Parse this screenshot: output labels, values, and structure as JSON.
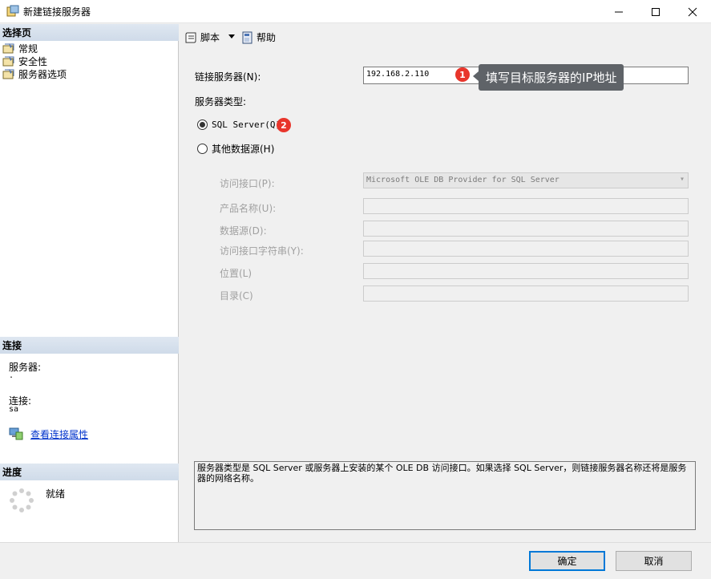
{
  "window": {
    "title": "新建链接服务器",
    "min_icon": "minimize-icon",
    "max_icon": "maximize-icon",
    "close_icon": "close-icon"
  },
  "left": {
    "select_page_header": "选择页",
    "pages": [
      {
        "label": "常规",
        "icon": "page-icon"
      },
      {
        "label": "安全性",
        "icon": "page-icon"
      },
      {
        "label": "服务器选项",
        "icon": "page-icon"
      }
    ],
    "connection_header": "连接",
    "server_label": "服务器:",
    "server_value": ".",
    "connection_label": "连接:",
    "connection_value": "sa",
    "view_props_link": "查看连接属性",
    "progress_header": "进度",
    "progress_status": "就绪"
  },
  "toolbar": {
    "script_label": "脚本",
    "help_label": "帮助"
  },
  "form": {
    "linked_server_label": "链接服务器(N):",
    "linked_server_value": "192.168.2.110",
    "server_type_label": "服务器类型:",
    "radio_sql_server": "SQL Server(Q)",
    "radio_other": "其他数据源(H)",
    "selected_server_type": "SQL Server(Q)",
    "provider_label": "访问接口(P):",
    "provider_value": "Microsoft OLE DB Provider for SQL Server",
    "product_name_label": "产品名称(U):",
    "data_source_label": "数据源(D):",
    "provider_string_label": "访问接口字符串(Y):",
    "location_label": "位置(L)",
    "catalog_label": "目录(C)"
  },
  "annotations": {
    "badge1": "1",
    "badge2": "2",
    "tooltip1": "填写目标服务器的IP地址",
    "badge_color": "#e8352b"
  },
  "description": "服务器类型是 SQL Server 或服务器上安装的某个 OLE DB 访问接口。如果选择 SQL Server，则链接服务器名称还将是服务器的网络名称。",
  "buttons": {
    "ok": "确定",
    "cancel": "取消"
  },
  "colors": {
    "accent": "#0078d7",
    "link": "#0033cc",
    "header_bg": "#cfdbe9"
  }
}
